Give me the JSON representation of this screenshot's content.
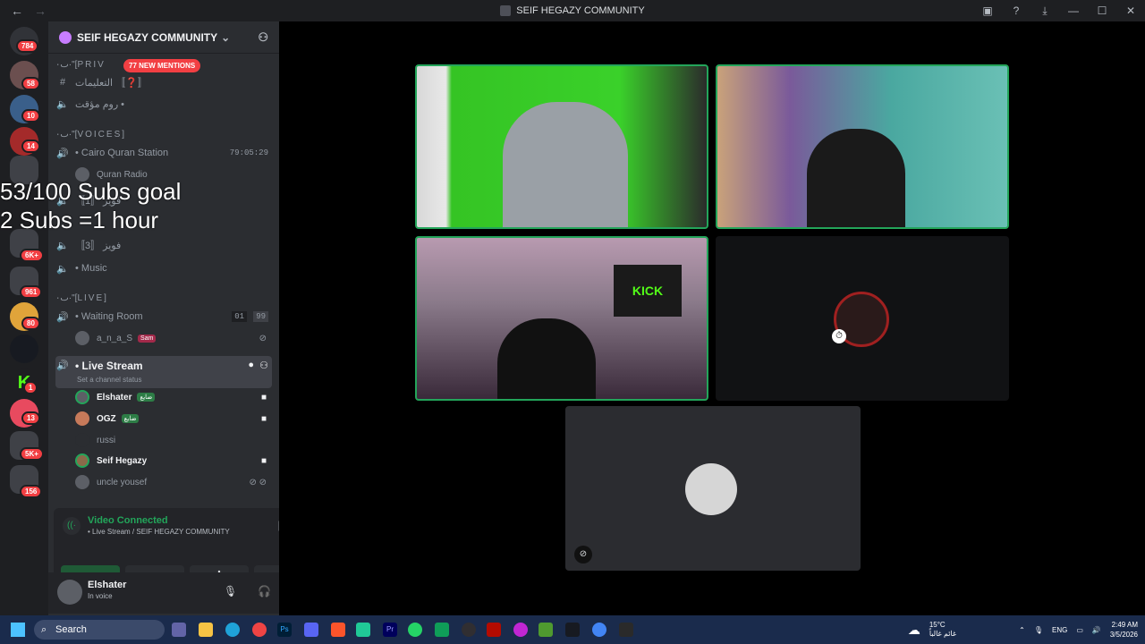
{
  "window": {
    "title": "SEIF HEGAZY COMMUNITY"
  },
  "guild_badges": [
    "784",
    "58",
    "10",
    "14",
    "6K+",
    "961",
    "80",
    "1",
    "13",
    "5K+",
    "156"
  ],
  "server": {
    "name": "SEIF HEGAZY COMMUNITY",
    "mentions": "77 NEW MENTIONS"
  },
  "channels": {
    "cat_private": "ٮ٠·\"[PRIV",
    "instructions": "التعليمات 〚❓〛",
    "temp_room": "روم مؤقت •",
    "cat_voices": "ٮ٠·\"[VOICES]",
    "cairo_quran": "• Cairo Quran Station",
    "cairo_time": "79:05:29",
    "quran_radio": "Quran Radio",
    "voice3": "فويز 〚3〛",
    "music": "• Music",
    "cat_live": "ٮ٠·\"[LIVE]",
    "waiting_room": "• Waiting Room",
    "waiting_count_a": "01",
    "waiting_count_b": "99",
    "waiting_user": "a_n_a_S",
    "waiting_tag": "Sam",
    "live_stream": "• Live Stream",
    "live_status": "Set a channel status",
    "users": [
      {
        "name": "Elshater",
        "tag": "ضايع"
      },
      {
        "name": "OGZ",
        "tag": "ضايع"
      },
      {
        "name": "russi",
        "tag": ""
      },
      {
        "name": "Seif Hegazy",
        "tag": ""
      },
      {
        "name": "uncle yousef",
        "tag": ""
      }
    ]
  },
  "voice_panel": {
    "title": "Video Connected",
    "subtitle": "• Live Stream / SEIF HEGAZY COMMUNITY"
  },
  "user_panel": {
    "name": "Elshater",
    "status": "In voice"
  },
  "overlay": {
    "line1": "53/100 Subs goal",
    "line2": "2 Subs =1 hour"
  },
  "taskbar": {
    "search": "Search",
    "weather_temp": "15°C",
    "weather_desc": "غائم غالباً",
    "lang": "ENG",
    "time": "2:49 AM",
    "date": "3/5/2026"
  },
  "colors": {
    "speaking": "#23a55a",
    "badge": "#f23f43",
    "accent": "#5865f2"
  }
}
